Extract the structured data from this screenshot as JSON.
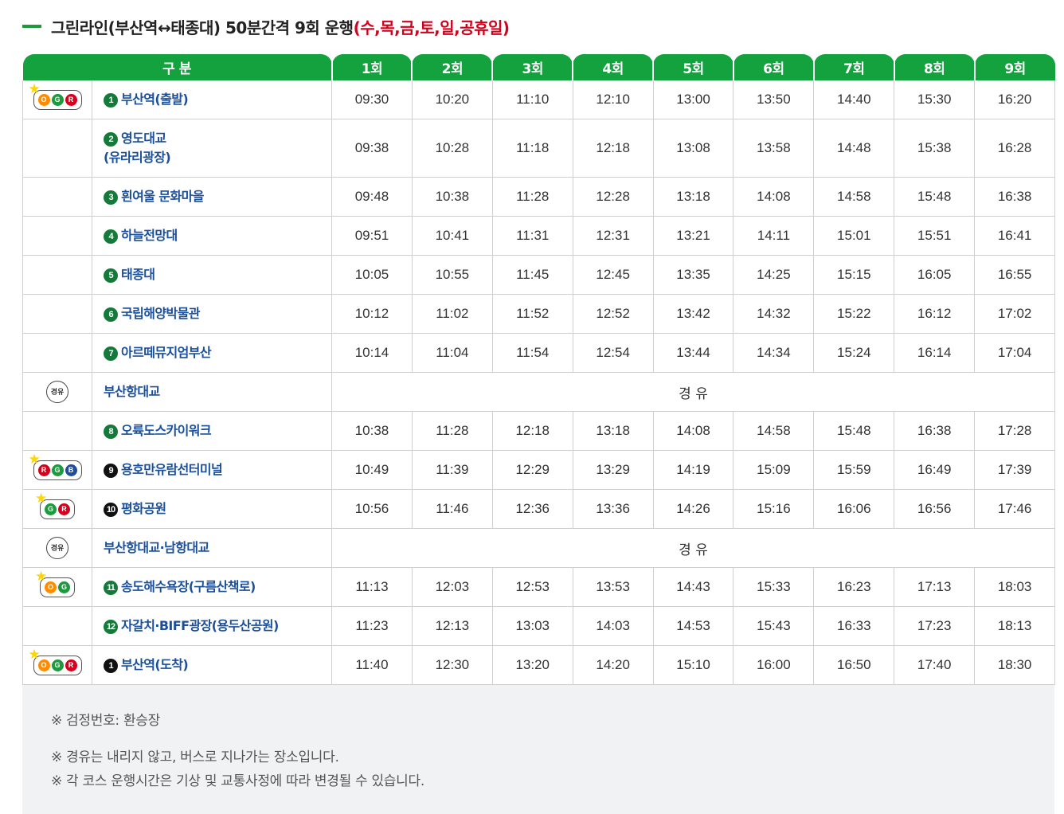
{
  "title": {
    "main": "그린라인(부산역↔태종대) 50분간격 9회 운행",
    "days": "(수,목,금,토,일,공휴일)"
  },
  "header": {
    "section_label": "구 분",
    "runs": [
      "1회",
      "2회",
      "3회",
      "4회",
      "5회",
      "6회",
      "7회",
      "8회",
      "9회"
    ]
  },
  "rows": [
    {
      "type": "stop",
      "icon": "ogr",
      "num": "1",
      "num_style": "g",
      "name": "부산역(출발)",
      "times": [
        "09:30",
        "10:20",
        "11:10",
        "12:10",
        "13:00",
        "13:50",
        "14:40",
        "15:30",
        "16:20"
      ]
    },
    {
      "type": "stop",
      "icon": "",
      "num": "2",
      "num_style": "g",
      "name": "영도대교",
      "name2": "(유라리광장)",
      "times": [
        "09:38",
        "10:28",
        "11:18",
        "12:18",
        "13:08",
        "13:58",
        "14:48",
        "15:38",
        "16:28"
      ]
    },
    {
      "type": "stop",
      "icon": "",
      "num": "3",
      "num_style": "g",
      "name": "흰여울 문화마을",
      "times": [
        "09:48",
        "10:38",
        "11:28",
        "12:28",
        "13:18",
        "14:08",
        "14:58",
        "15:48",
        "16:38"
      ]
    },
    {
      "type": "stop",
      "icon": "",
      "num": "4",
      "num_style": "g",
      "name": "하늘전망대",
      "times": [
        "09:51",
        "10:41",
        "11:31",
        "12:31",
        "13:21",
        "14:11",
        "15:01",
        "15:51",
        "16:41"
      ]
    },
    {
      "type": "stop",
      "icon": "",
      "num": "5",
      "num_style": "g",
      "name": "태종대",
      "times": [
        "10:05",
        "10:55",
        "11:45",
        "12:45",
        "13:35",
        "14:25",
        "15:15",
        "16:05",
        "16:55"
      ]
    },
    {
      "type": "stop",
      "icon": "",
      "num": "6",
      "num_style": "g",
      "name": "국립해양박물관",
      "times": [
        "10:12",
        "11:02",
        "11:52",
        "12:52",
        "13:42",
        "14:32",
        "15:22",
        "16:12",
        "17:02"
      ]
    },
    {
      "type": "stop",
      "icon": "",
      "num": "7",
      "num_style": "g",
      "name": "아르떼뮤지엄부산",
      "times": [
        "10:14",
        "11:04",
        "11:54",
        "12:54",
        "13:44",
        "14:34",
        "15:24",
        "16:14",
        "17:04"
      ]
    },
    {
      "type": "via",
      "icon_text": "경유",
      "name": "부산항대교",
      "via_text": "경 유"
    },
    {
      "type": "stop",
      "icon": "",
      "num": "8",
      "num_style": "g",
      "name": "오륙도스카이워크",
      "times": [
        "10:38",
        "11:28",
        "12:18",
        "13:18",
        "14:08",
        "14:58",
        "15:48",
        "16:38",
        "17:28"
      ]
    },
    {
      "type": "stop",
      "icon": "rgb",
      "num": "9",
      "num_style": "k",
      "name": "용호만유람선터미널",
      "times": [
        "10:49",
        "11:39",
        "12:29",
        "13:29",
        "14:19",
        "15:09",
        "15:59",
        "16:49",
        "17:39"
      ]
    },
    {
      "type": "stop",
      "icon": "gr",
      "num": "10",
      "num_style": "k",
      "name": "평화공원",
      "times": [
        "10:56",
        "11:46",
        "12:36",
        "13:36",
        "14:26",
        "15:16",
        "16:06",
        "16:56",
        "17:46"
      ]
    },
    {
      "type": "via",
      "icon_text": "경유",
      "name": "부산항대교·남항대교",
      "via_text": "경 유"
    },
    {
      "type": "stop",
      "icon": "og",
      "num": "11",
      "num_style": "g",
      "name": "송도해수욕장(구름산책로)",
      "times": [
        "11:13",
        "12:03",
        "12:53",
        "13:53",
        "14:43",
        "15:33",
        "16:23",
        "17:13",
        "18:03"
      ]
    },
    {
      "type": "stop",
      "icon": "",
      "num": "12",
      "num_style": "g",
      "name": "자갈치·BIFF광장(용두산공원)",
      "times": [
        "11:23",
        "12:13",
        "13:03",
        "14:03",
        "14:53",
        "15:43",
        "16:33",
        "17:23",
        "18:13"
      ]
    },
    {
      "type": "stop",
      "icon": "ogr",
      "num": "1",
      "num_style": "k",
      "name": "부산역(도착)",
      "times": [
        "11:40",
        "12:30",
        "13:20",
        "14:20",
        "15:10",
        "16:00",
        "16:50",
        "17:40",
        "18:30"
      ]
    }
  ],
  "badge_letters": {
    "o": "O",
    "gr": "G",
    "r": "R",
    "b": "B"
  },
  "notes": [
    "※ 검정번호: 환승장",
    "※ 경유는 내리지 않고, 버스로 지나가는 장소입니다.",
    "※ 각 코스 운행시간은 기상 및 교통사정에 따라 변경될 수 있습니다."
  ],
  "colors": {
    "header_green": "#13a23d",
    "stop_blue": "#1a4f9c",
    "days_red": "#d0021b"
  }
}
